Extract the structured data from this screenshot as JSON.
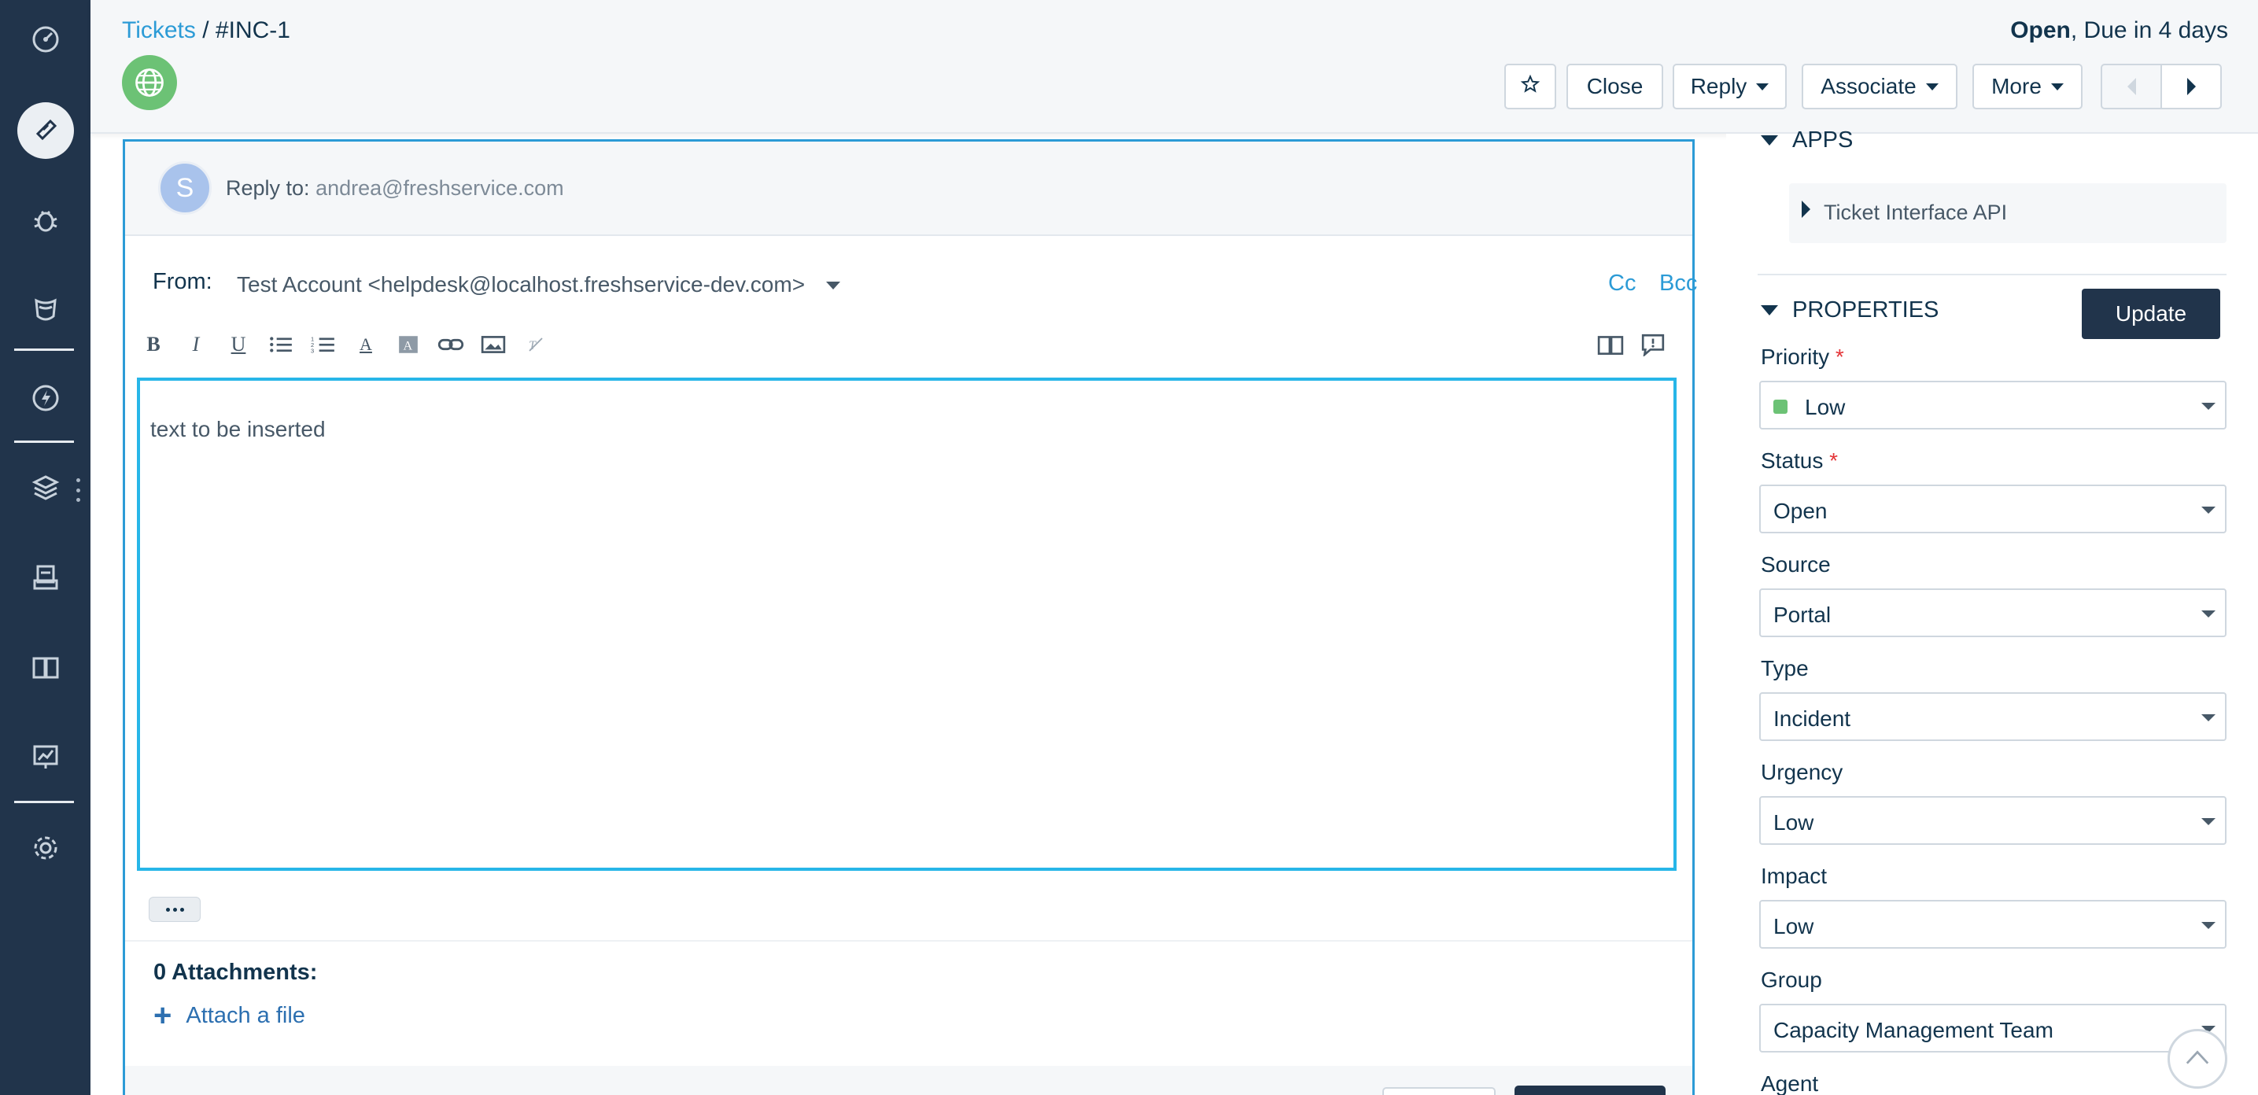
{
  "header": {
    "breadcrumb_link": "Tickets",
    "breadcrumb_sep": " / ",
    "ticket_id": "#INC-1",
    "status_bold": "Open",
    "status_rest": ", Due in 4 days",
    "buttons": {
      "close": "Close",
      "reply": "Reply",
      "associate": "Associate",
      "more": "More"
    }
  },
  "reply": {
    "avatar_letter": "S",
    "reply_to_label": "Reply to:",
    "reply_to_address": "andrea@freshservice.com",
    "from_label": "From:",
    "from_value": "Test Account <helpdesk@localhost.freshservice-dev.com>",
    "cc": "Cc",
    "bcc": "Bcc",
    "body_text": "text to be inserted",
    "attachments_label": "0 Attachments:",
    "attach_link": "Attach a file"
  },
  "right_panel": {
    "apps_title": "APPS",
    "app_item": "Ticket Interface API",
    "properties_title": "PROPERTIES",
    "update_button": "Update",
    "fields": {
      "priority": {
        "label": "Priority",
        "value": "Low",
        "required": "*"
      },
      "status": {
        "label": "Status",
        "value": "Open",
        "required": "*"
      },
      "source": {
        "label": "Source",
        "value": "Portal"
      },
      "type": {
        "label": "Type",
        "value": "Incident"
      },
      "urgency": {
        "label": "Urgency",
        "value": "Low"
      },
      "impact": {
        "label": "Impact",
        "value": "Low"
      },
      "group": {
        "label": "Group",
        "value": "Capacity Management Team"
      },
      "agent": {
        "label": "Agent"
      }
    }
  },
  "colors": {
    "nav_bg": "#21344b",
    "accent_blue": "#2c9bd6",
    "editor_border": "#27b6e8",
    "priority_low": "#6cc275",
    "required": "#e43538"
  },
  "icons": {
    "nav": [
      "dashboard-icon",
      "tickets-icon",
      "problems-icon",
      "changes-icon",
      "releases-icon",
      "assets-icon",
      "purchase-orders-icon",
      "solutions-icon",
      "reports-icon",
      "admin-gear-icon"
    ]
  }
}
